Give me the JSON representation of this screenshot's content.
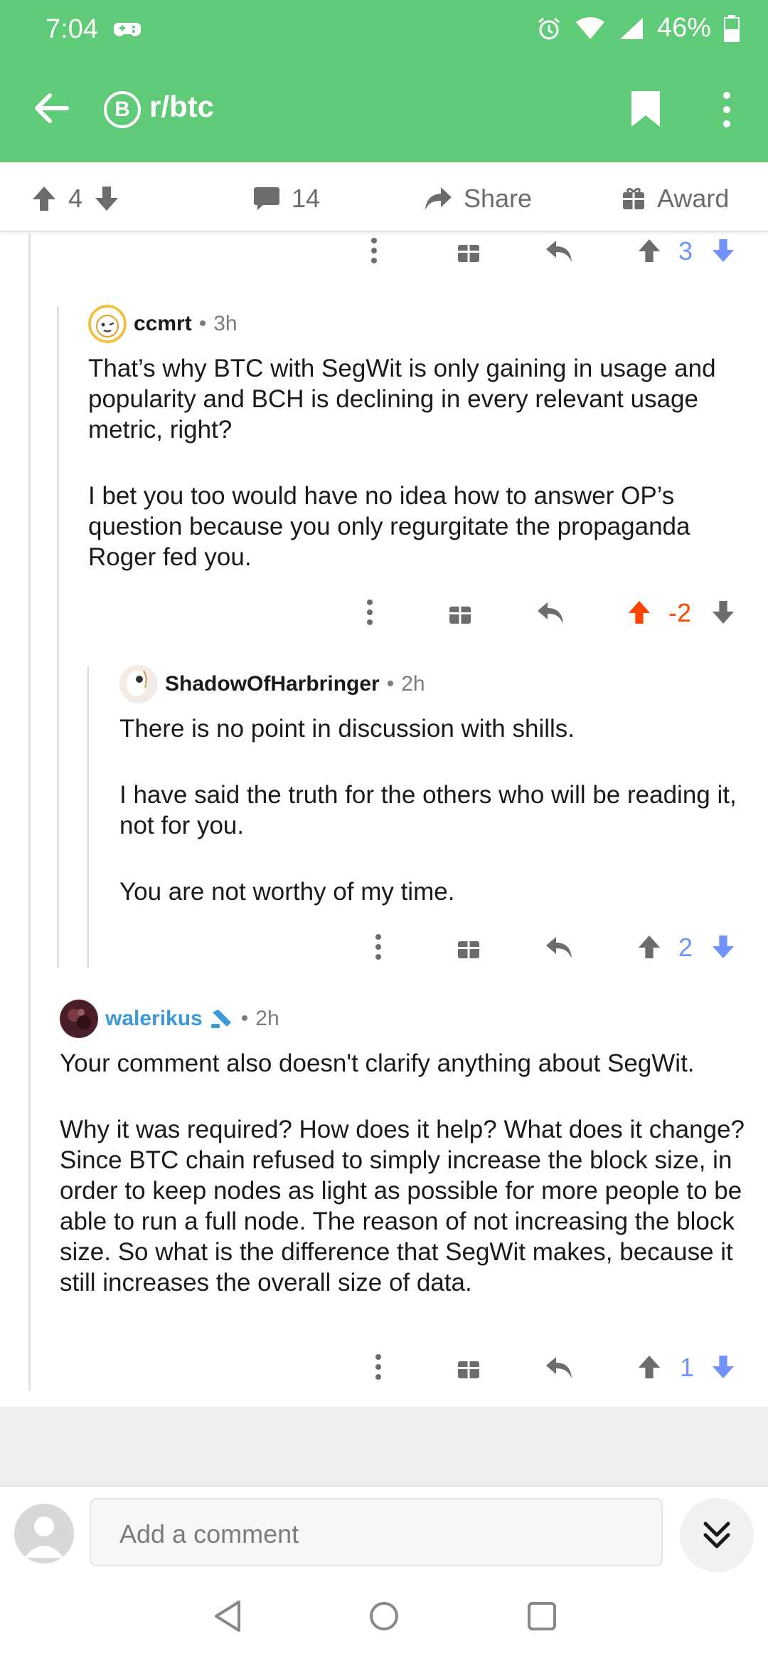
{
  "status": {
    "time": "7:04",
    "battery": "46%"
  },
  "header": {
    "subreddit": "r/btc",
    "sub_icon_letter": "B"
  },
  "post_bar": {
    "score": "4",
    "comments": "14",
    "share_label": "Share",
    "award_label": "Award"
  },
  "top_actions": {
    "score": "3"
  },
  "comments": [
    {
      "user": "ccmrt",
      "age": "3h",
      "paragraphs": [
        "That’s why BTC with SegWit is only gaining in usage and popularity and BCH is declining in every relevant usage metric, right?",
        "I bet you too would have no idea how to answer OP’s question because you only regurgitate the propaganda Roger fed you."
      ],
      "score": "-2"
    },
    {
      "user": "ShadowOfHarbringer",
      "age": "2h",
      "paragraphs": [
        "There is no point in discussion with shills.",
        "I have said the truth for the others who will be reading it, not for you.",
        "You are not worthy of my time."
      ],
      "score": "2"
    },
    {
      "user": "walerikus",
      "age": "2h",
      "paragraphs": [
        "Your comment also doesn't clarify anything about SegWit.",
        "Why it was required? How does it help? What does it change? Since BTC chain refused to simply increase the block size, in order to keep nodes as light as possible for more people to be able to run a full node. The reason of not increasing the block size. So what is the difference that SegWit makes, because it still increases the overall size of data."
      ],
      "score": "1"
    }
  ],
  "composer": {
    "placeholder": "Add a comment"
  },
  "colors": {
    "accent": "#5fcb78",
    "upvote": "#ff4500",
    "downvote": "#7193ff",
    "gray": "#6c6c6c"
  }
}
